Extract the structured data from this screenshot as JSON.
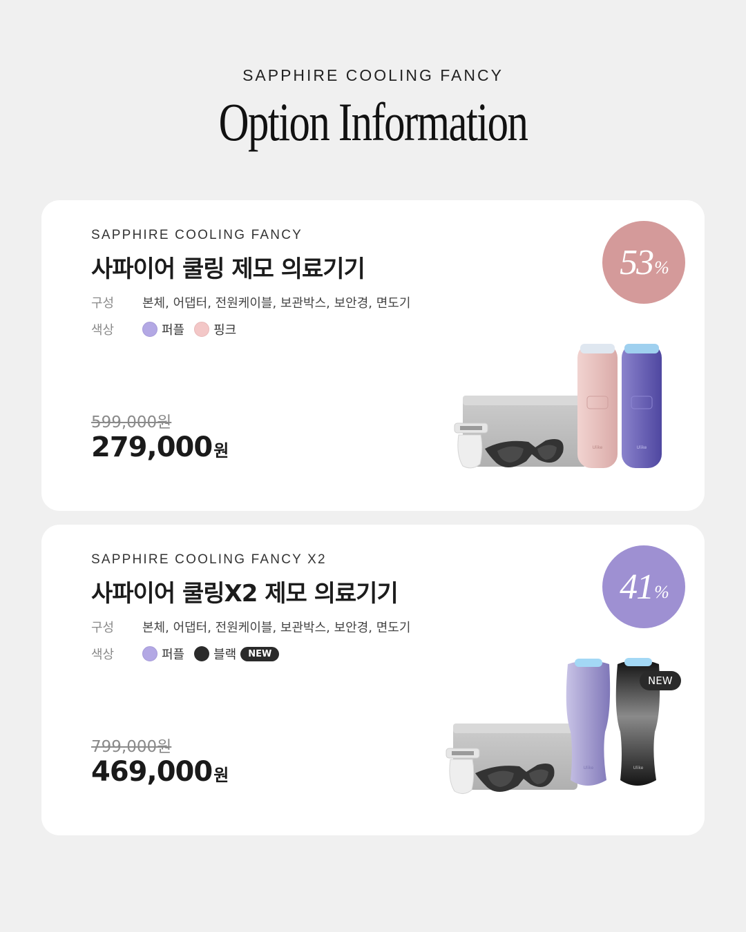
{
  "header": {
    "eyebrow": "SAPPHIRE COOLING FANCY",
    "title": "Option Information"
  },
  "products": [
    {
      "eyebrow": "SAPPHIRE COOLING FANCY",
      "title": "사파이어 쿨링 제모 의료기기",
      "composition_label": "구성",
      "composition": "본체, 어댑터, 전원케이블, 보관박스, 보안경, 면도기",
      "color_label": "색상",
      "colors": [
        {
          "name": "퍼플",
          "hex": "#b3a8e4"
        },
        {
          "name": "핑크",
          "hex": "#f3c7c7"
        }
      ],
      "original_price": "599,000원",
      "sale_price": "279,000",
      "currency": "원",
      "discount": "53",
      "discount_unit": "%",
      "badge_color": "#d49a9a",
      "device_colors": [
        "#e8c2c0",
        "#6e66b8"
      ],
      "device_brand": "Ulike"
    },
    {
      "eyebrow": "SAPPHIRE COOLING FANCY X2",
      "title": "사파이어 쿨링X2 제모 의료기기",
      "composition_label": "구성",
      "composition": "본체, 어댑터, 전원케이블, 보관박스, 보안경, 면도기",
      "color_label": "색상",
      "colors": [
        {
          "name": "퍼플",
          "hex": "#b3a8e4"
        },
        {
          "name": "블랙",
          "hex": "#2b2b2b",
          "new": "NEW"
        }
      ],
      "original_price": "799,000원",
      "sale_price": "469,000",
      "currency": "원",
      "discount": "41",
      "discount_unit": "%",
      "badge_color": "#9e90d2",
      "device_colors": [
        "#a9a2cf",
        "#1f1f1f"
      ],
      "device_brand": "Ulike",
      "image_new_tag": "NEW"
    }
  ]
}
